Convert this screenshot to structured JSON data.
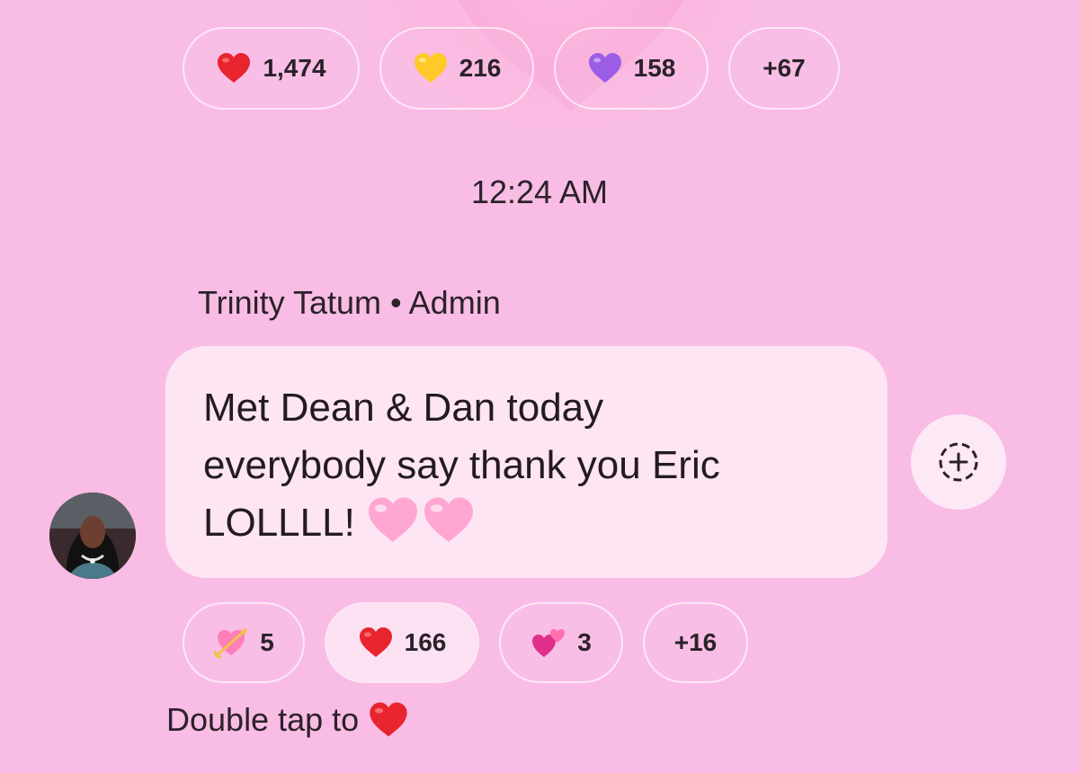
{
  "top_reactions": [
    {
      "icon": "red-heart-icon",
      "count": "1,474",
      "color": "#e8242f"
    },
    {
      "icon": "yellow-heart-icon",
      "count": "216",
      "color": "#ffc928"
    },
    {
      "icon": "purple-heart-icon",
      "count": "158",
      "color": "#9b5de5"
    },
    {
      "icon": null,
      "count": "+67"
    }
  ],
  "timestamp": "12:24 AM",
  "message": {
    "sender": "Trinity Tatum • Admin",
    "lines": [
      "Met Dean & Dan today",
      "everybody say thank you Eric",
      "LOLLLL!"
    ],
    "trailing_emoji": [
      "pink-heart-icon",
      "pink-heart-icon"
    ],
    "avatar": "sender-avatar",
    "add_reaction_icon": "add-reaction-icon"
  },
  "bottom_reactions": [
    {
      "icon": "heart-with-arrow-icon",
      "count": "5"
    },
    {
      "icon": "red-heart-icon",
      "count": "166",
      "active": true
    },
    {
      "icon": "two-hearts-icon",
      "count": "3"
    },
    {
      "icon": null,
      "count": "+16"
    }
  ],
  "hint": {
    "text": "Double tap to",
    "icon": "red-heart-icon"
  },
  "colors": {
    "background": "#f9bce4",
    "bubble": "#fde5f4",
    "red_heart": "#e8242f",
    "pink_heart": "#ffa6d2"
  }
}
